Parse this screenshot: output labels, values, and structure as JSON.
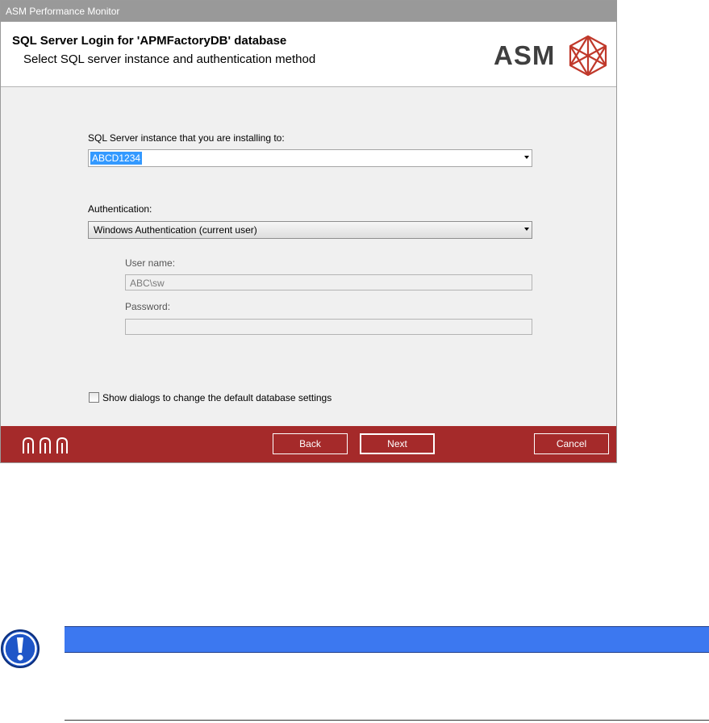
{
  "window": {
    "title": "ASM Performance Monitor"
  },
  "header": {
    "title": "SQL Server Login for 'APMFactoryDB' database",
    "subtitle": "Select SQL server instance and authentication method",
    "logo_text": "ASM"
  },
  "form": {
    "instance_label": "SQL Server instance that you are installing to:",
    "instance_value": "ABCD1234",
    "auth_label": "Authentication:",
    "auth_value": "Windows Authentication (current user)",
    "username_label": "User name:",
    "username_value": "ABC\\sw",
    "password_label": "Password:",
    "password_value": "",
    "show_dialogs_label": "Show dialogs to change the default database settings",
    "show_dialogs_checked": false
  },
  "footer": {
    "back_label": "Back",
    "next_label": "Next",
    "cancel_label": "Cancel"
  },
  "colors": {
    "titlebar": "#999999",
    "footer": "#a52a2a",
    "logo_red": "#c0392b",
    "notice_bar": "#3c78f0",
    "notice_icon": "#1f56c8"
  },
  "icons": {
    "logo_mark": "asm-crystal-icon",
    "footer_mark": "asm-arches-icon",
    "notice": "exclamation-icon"
  }
}
